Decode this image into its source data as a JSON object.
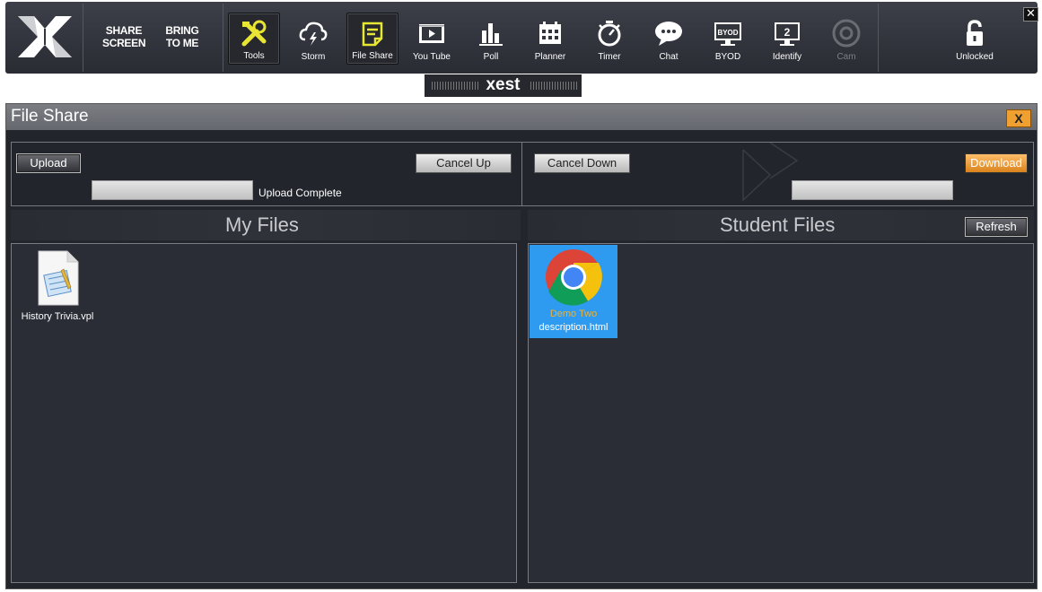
{
  "toolbar": {
    "share_screen": [
      "SHARE",
      "SCREEN"
    ],
    "bring_to_me": [
      "BRING",
      "TO ME"
    ],
    "tools": [
      {
        "label": "Tools",
        "icon": "tools-icon",
        "active": true
      },
      {
        "label": "Storm",
        "icon": "storm-cloud-icon"
      },
      {
        "label": "File Share",
        "icon": "file-share-icon",
        "active": true
      },
      {
        "label": "You Tube",
        "icon": "youtube-film-icon"
      },
      {
        "label": "Poll",
        "icon": "poll-chart-icon"
      },
      {
        "label": "Planner",
        "icon": "planner-calendar-icon"
      },
      {
        "label": "Timer",
        "icon": "timer-stopwatch-icon"
      },
      {
        "label": "Chat",
        "icon": "chat-bubble-icon"
      },
      {
        "label": "BYOD",
        "icon": "byod-monitor-icon",
        "badge": "BYOD"
      },
      {
        "label": "Identify",
        "icon": "identify-monitor-icon",
        "badge": "2"
      },
      {
        "label": "Cam",
        "icon": "cam-icon",
        "disabled": true
      }
    ],
    "unlocked": "Unlocked",
    "close": "✕"
  },
  "brand": {
    "text": "xest"
  },
  "window": {
    "title": "File Share",
    "close_label": "X",
    "upload_label": "Upload",
    "cancel_up_label": "Cancel Up",
    "upload_status": "Upload Complete",
    "cancel_down_label": "Cancel Down",
    "download_label": "Download",
    "my_files_title": "My Files",
    "student_files_title": "Student Files",
    "refresh_label": "Refresh",
    "my_files": [
      {
        "name": "History Trivia.vpl",
        "icon": "notepad-file-icon"
      }
    ],
    "student_files": [
      {
        "line1": "Demo Two",
        "line2": "description.html",
        "icon": "chrome-icon",
        "selected": true
      }
    ]
  },
  "colors": {
    "toolbar_bg": "#33353d",
    "accent_yellow": "#e8e632",
    "window_bg": "#23252d",
    "selected_blue": "#2f9bf0",
    "close_orange": "#f0a030"
  }
}
